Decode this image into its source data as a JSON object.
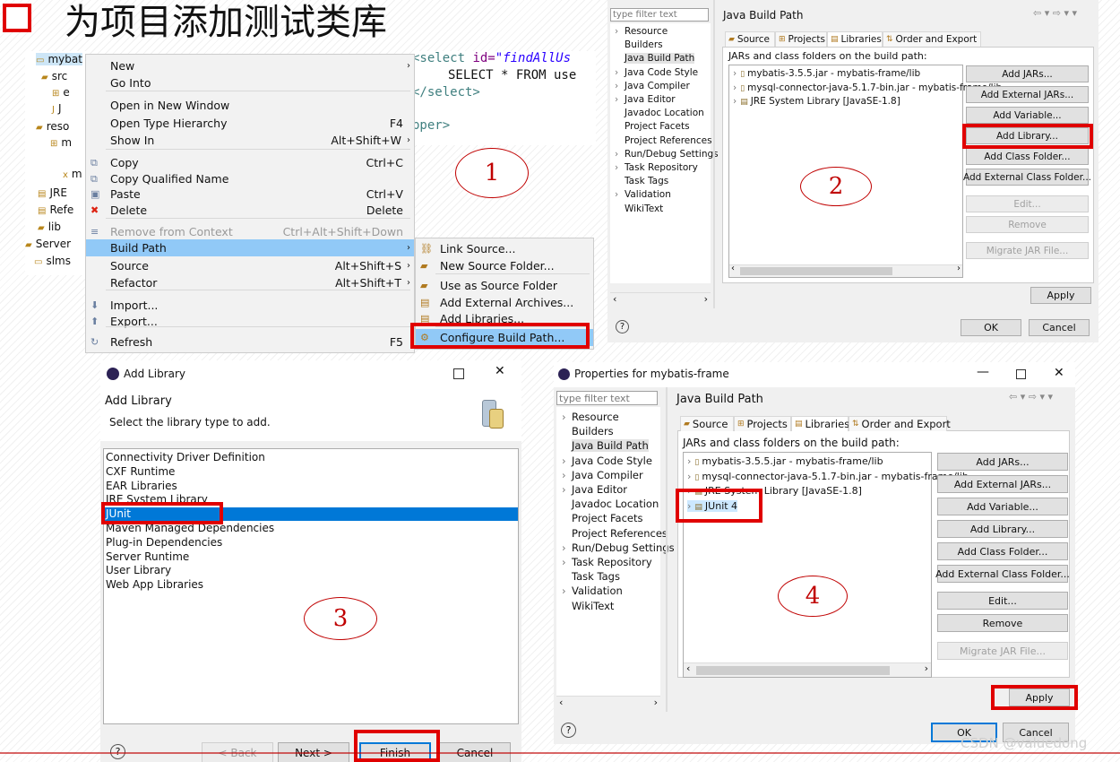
{
  "slide": {
    "title": "为项目添加测试类库",
    "watermark": "CSDN @valuedong"
  },
  "step_labels": [
    "1",
    "2",
    "3",
    "4"
  ],
  "explorer": {
    "items": [
      {
        "label": "mybat",
        "icon": "project-icon"
      },
      {
        "label": "src",
        "icon": "folder-icon"
      },
      {
        "label": "e",
        "icon": "package-icon"
      },
      {
        "label": "J",
        "icon": "java-file-icon"
      },
      {
        "label": "reso",
        "icon": "folder-icon"
      },
      {
        "label": "m",
        "icon": "package-icon"
      },
      {
        "label": "m",
        "icon": "xml-file-icon"
      },
      {
        "label": "JRE",
        "icon": "library-icon"
      },
      {
        "label": "Refe",
        "icon": "library-icon"
      },
      {
        "label": "lib",
        "icon": "folder-icon"
      },
      {
        "label": "Server",
        "icon": "folder-icon"
      },
      {
        "label": "slms",
        "icon": "project-icon"
      }
    ]
  },
  "code": {
    "line1_tag": "<select",
    "line1_attr": " id=",
    "line1_val": "\"findAllUs",
    "line2": "SELECT * FROM use",
    "line3": "</select>",
    "line5": "pper>"
  },
  "context_menu": {
    "items": [
      {
        "label": "New",
        "shortcut": "",
        "sub": true
      },
      {
        "label": "Go Into",
        "shortcut": ""
      },
      {
        "label": "Open in New Window",
        "shortcut": ""
      },
      {
        "label": "Open Type Hierarchy",
        "shortcut": "F4"
      },
      {
        "label": "Show In",
        "shortcut": "Alt+Shift+W",
        "sub": true
      },
      {
        "label": "Copy",
        "shortcut": "Ctrl+C"
      },
      {
        "label": "Copy Qualified Name",
        "shortcut": ""
      },
      {
        "label": "Paste",
        "shortcut": "Ctrl+V"
      },
      {
        "label": "Delete",
        "shortcut": "Delete"
      },
      {
        "label": "Remove from Context",
        "shortcut": "Ctrl+Alt+Shift+Down"
      },
      {
        "label": "Build Path",
        "shortcut": "",
        "sub": true
      },
      {
        "label": "Source",
        "shortcut": "Alt+Shift+S",
        "sub": true
      },
      {
        "label": "Refactor",
        "shortcut": "Alt+Shift+T",
        "sub": true
      },
      {
        "label": "Import...",
        "shortcut": ""
      },
      {
        "label": "Export...",
        "shortcut": ""
      },
      {
        "label": "Refresh",
        "shortcut": "F5"
      }
    ]
  },
  "submenu": {
    "items": [
      "Link Source...",
      "New Source Folder...",
      "Use as Source Folder",
      "Add External Archives...",
      "Add Libraries...",
      "Configure Build Path..."
    ]
  },
  "props": {
    "filter_placeholder": "type filter text",
    "page_title": "Java Build Path",
    "tree": [
      "Resource",
      "Builders",
      "Java Build Path",
      "Java Code Style",
      "Java Compiler",
      "Java Editor",
      "Javadoc Location",
      "Project Facets",
      "Project References",
      "Run/Debug Settings",
      "Task Repository",
      "Task Tags",
      "Validation",
      "WikiText"
    ],
    "tabs": [
      "Source",
      "Projects",
      "Libraries",
      "Order and Export"
    ],
    "subtitle": "JARs and class folders on the build path:",
    "entries": [
      "mybatis-3.5.5.jar - mybatis-frame/lib",
      "mysql-connector-java-5.1.7-bin.jar - mybatis-frame/lib",
      "JRE System Library [JavaSE-1.8]",
      "JUnit 4"
    ],
    "buttons": [
      "Add JARs...",
      "Add External JARs...",
      "Add Variable...",
      "Add Library...",
      "Add Class Folder...",
      "Add External Class Folder...",
      "Edit...",
      "Remove",
      "Migrate JAR File..."
    ],
    "apply": "Apply",
    "ok": "OK",
    "cancel": "Cancel"
  },
  "add_library": {
    "window_title": "Add Library",
    "heading": "Add Library",
    "instruction": "Select the library type to add.",
    "types": [
      "Connectivity Driver Definition",
      "CXF Runtime",
      "EAR Libraries",
      "JRE System Library",
      "JUnit",
      "Maven Managed Dependencies",
      "Plug-in Dependencies",
      "Server Runtime",
      "User Library",
      "Web App Libraries"
    ],
    "back": "< Back",
    "next": "Next >",
    "finish": "Finish",
    "cancel": "Cancel"
  },
  "props_window": {
    "title": "Properties for mybatis-frame"
  },
  "colors": {
    "accent_red": "#e00000",
    "selection": "#0078d7",
    "menu_highlight": "#91c9f7"
  }
}
